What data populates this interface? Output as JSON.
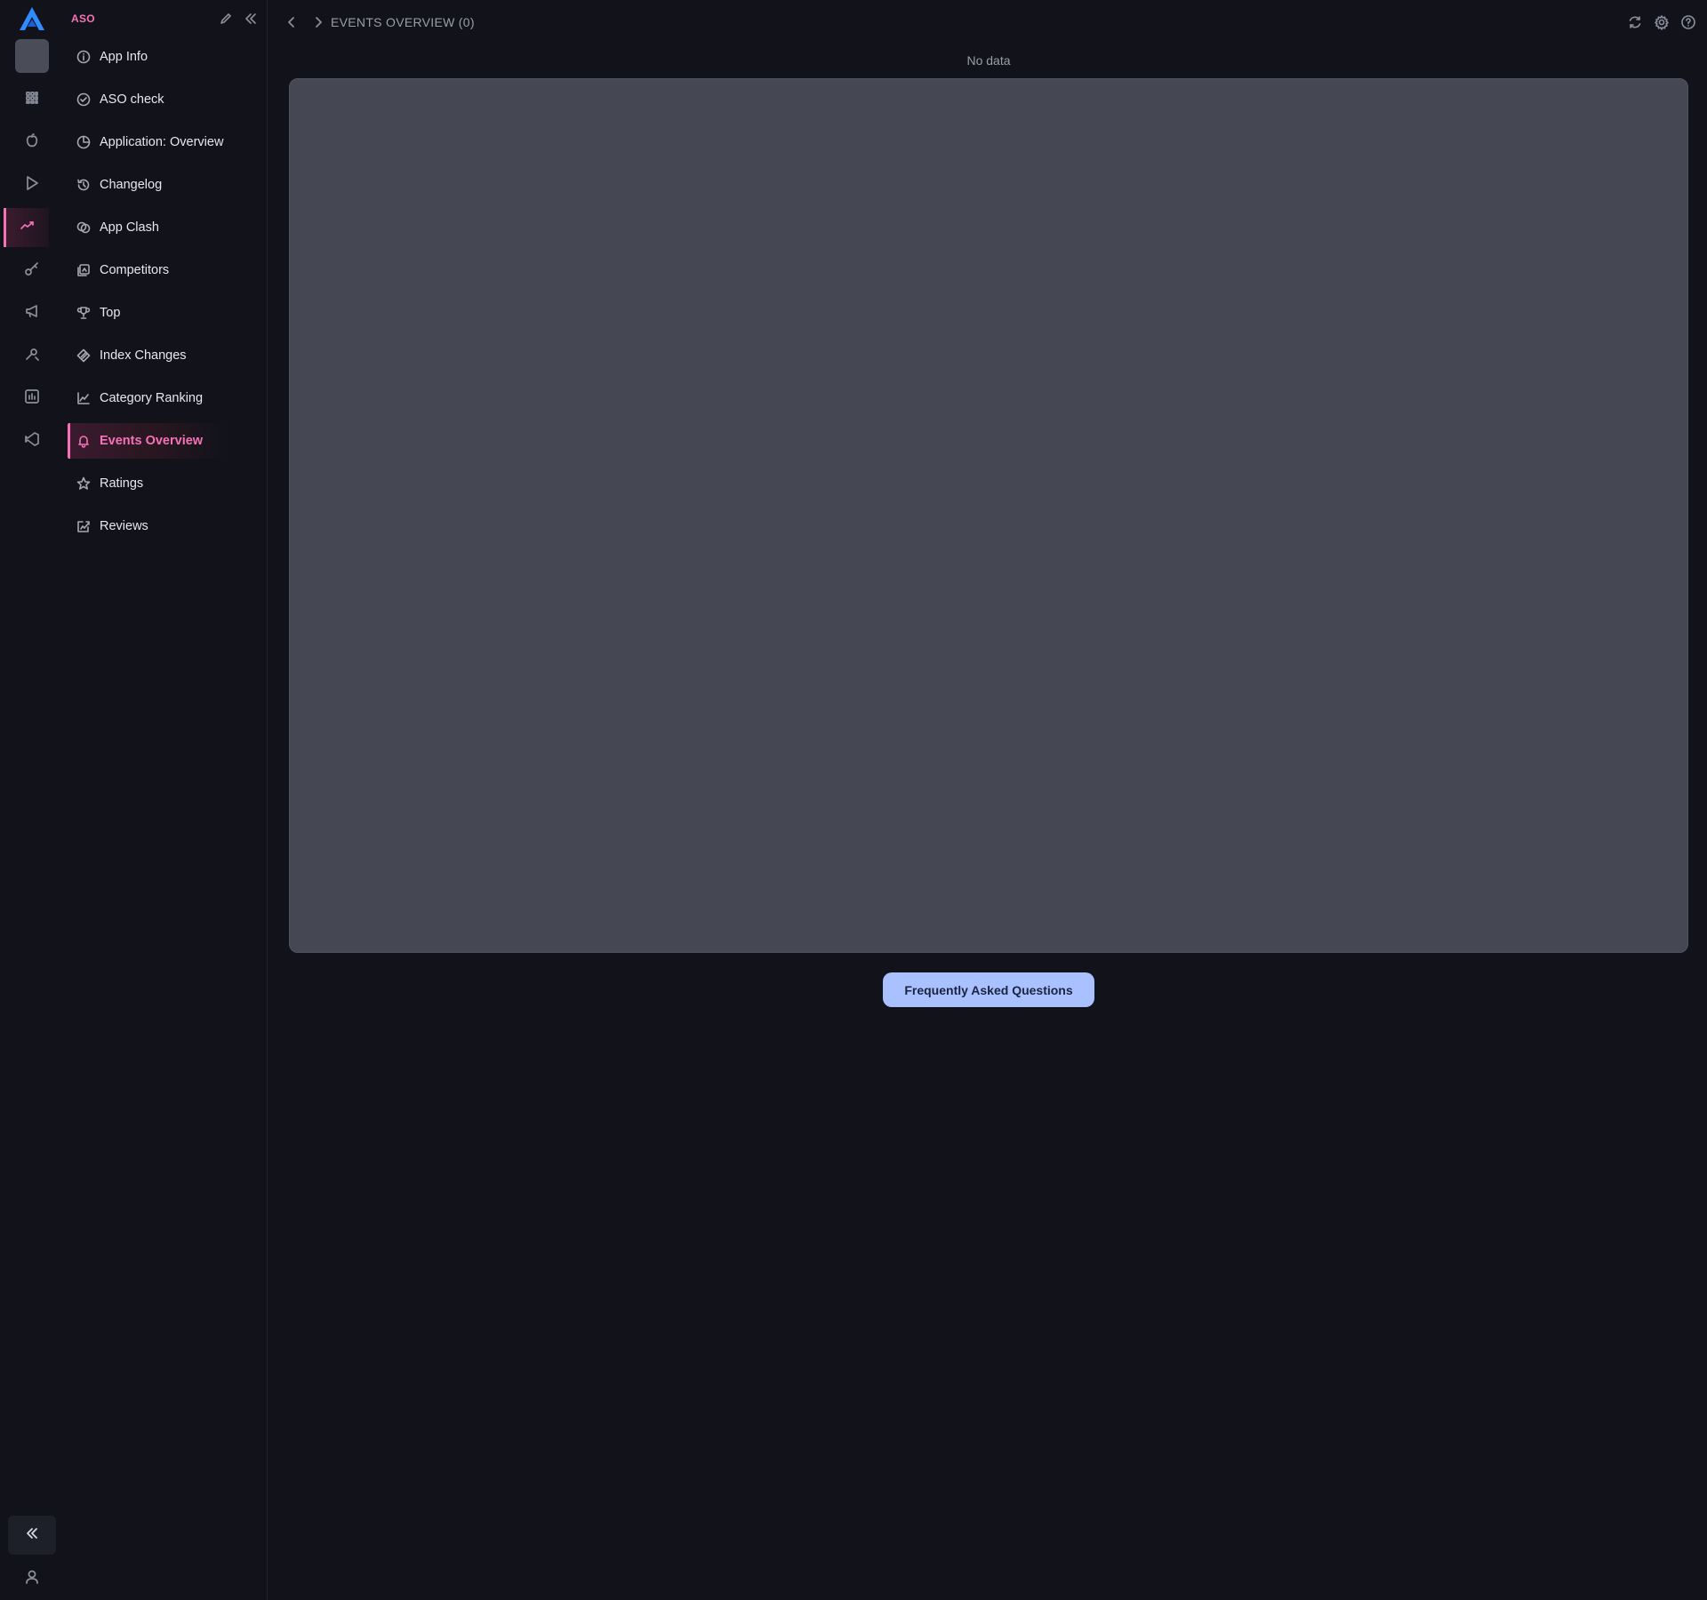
{
  "app": {
    "section_title": "ASO"
  },
  "rail": {
    "items": [
      {
        "icon": "grid-icon"
      },
      {
        "icon": "apple-icon"
      },
      {
        "icon": "play-store-icon"
      },
      {
        "icon": "trend-icon",
        "active": true
      },
      {
        "icon": "key-icon"
      },
      {
        "icon": "megaphone-icon"
      },
      {
        "icon": "tools-icon"
      },
      {
        "icon": "report-icon"
      },
      {
        "icon": "vscode-icon"
      }
    ]
  },
  "sidebar": {
    "items": [
      {
        "label": "App Info",
        "icon": "info-icon"
      },
      {
        "label": "ASO check",
        "icon": "check-circle-icon"
      },
      {
        "label": "Application: Overview",
        "icon": "pie-icon"
      },
      {
        "label": "Changelog",
        "icon": "history-icon"
      },
      {
        "label": "App Clash",
        "icon": "clash-icon"
      },
      {
        "label": "Competitors",
        "icon": "competitors-icon"
      },
      {
        "label": "Top",
        "icon": "trophy-icon"
      },
      {
        "label": "Index Changes",
        "icon": "index-icon"
      },
      {
        "label": "Category Ranking",
        "icon": "chart-line-icon"
      },
      {
        "label": "Events Overview",
        "icon": "bell-icon",
        "active": true
      },
      {
        "label": "Ratings",
        "icon": "star-icon"
      },
      {
        "label": "Reviews",
        "icon": "reviews-icon"
      }
    ]
  },
  "header": {
    "title": "EVENTS OVERVIEW (0)"
  },
  "main": {
    "empty_text": "No data",
    "faq_label": "Frequently Asked Questions"
  },
  "colors": {
    "accent": "#f472b6",
    "background": "#12131a",
    "panel": "#454852",
    "faq_button": "#a9c2ff"
  }
}
